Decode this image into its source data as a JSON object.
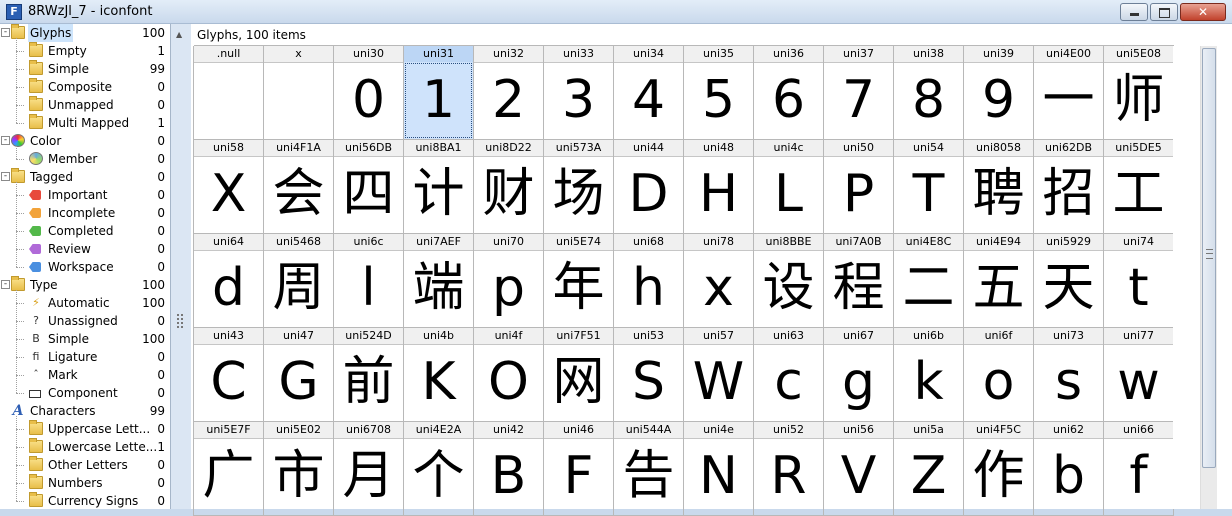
{
  "window": {
    "title": "8RWzJl_7 - iconfont",
    "app_icon_letter": "F",
    "close_glyph": "✕"
  },
  "tree": [
    {
      "label": "Glyphs",
      "count": "100",
      "level": 0,
      "icon": "folder-icon",
      "expander": "-",
      "selected": true
    },
    {
      "label": "Empty",
      "count": "1",
      "level": 1,
      "icon": "folder-icon"
    },
    {
      "label": "Simple",
      "count": "99",
      "level": 1,
      "icon": "folder-icon"
    },
    {
      "label": "Composite",
      "count": "0",
      "level": 1,
      "icon": "folder-icon"
    },
    {
      "label": "Unmapped",
      "count": "0",
      "level": 1,
      "icon": "folder-icon"
    },
    {
      "label": "Multi Mapped",
      "count": "1",
      "level": 1,
      "icon": "folder-icon"
    },
    {
      "label": "Color",
      "count": "0",
      "level": 0,
      "icon": "color-icon",
      "expander": "-"
    },
    {
      "label": "Member",
      "count": "0",
      "level": 1,
      "icon": "member-icon"
    },
    {
      "label": "Tagged",
      "count": "0",
      "level": 0,
      "icon": "folder-icon",
      "expander": "-"
    },
    {
      "label": "Important",
      "count": "0",
      "level": 1,
      "icon": "tag-icon",
      "tag": "t-important"
    },
    {
      "label": "Incomplete",
      "count": "0",
      "level": 1,
      "icon": "tag-icon",
      "tag": "t-incomplete"
    },
    {
      "label": "Completed",
      "count": "0",
      "level": 1,
      "icon": "tag-icon",
      "tag": "t-completed"
    },
    {
      "label": "Review",
      "count": "0",
      "level": 1,
      "icon": "tag-icon",
      "tag": "t-review"
    },
    {
      "label": "Workspace",
      "count": "0",
      "level": 1,
      "icon": "tag-icon",
      "tag": "t-workspace"
    },
    {
      "label": "Type",
      "count": "100",
      "level": 0,
      "icon": "folder-icon",
      "expander": "-"
    },
    {
      "label": "Automatic",
      "count": "100",
      "level": 1,
      "icon": "lightning-icon",
      "glyph": "⚡"
    },
    {
      "label": "Unassigned",
      "count": "0",
      "level": 1,
      "icon": "glyph-icon",
      "glyph": "?"
    },
    {
      "label": "Simple",
      "count": "100",
      "level": 1,
      "icon": "glyph-icon",
      "glyph": "B"
    },
    {
      "label": "Ligature",
      "count": "0",
      "level": 1,
      "icon": "glyph-icon",
      "glyph": "ﬁ"
    },
    {
      "label": "Mark",
      "count": "0",
      "level": 1,
      "icon": "glyph-icon",
      "glyph": "ˆ"
    },
    {
      "label": "Component",
      "count": "0",
      "level": 1,
      "icon": "component-icon"
    },
    {
      "label": "Characters",
      "count": "99",
      "level": 0,
      "icon": "chars-icon",
      "glyph": "A"
    },
    {
      "label": "Uppercase Lett...",
      "count": "0",
      "level": 1,
      "icon": "folder-icon"
    },
    {
      "label": "Lowercase Lette...",
      "count": "1",
      "level": 1,
      "icon": "folder-icon"
    },
    {
      "label": "Other Letters",
      "count": "0",
      "level": 1,
      "icon": "folder-icon"
    },
    {
      "label": "Numbers",
      "count": "0",
      "level": 1,
      "icon": "folder-icon"
    },
    {
      "label": "Currency Signs",
      "count": "0",
      "level": 1,
      "icon": "folder-icon"
    }
  ],
  "glyph_panel": {
    "header": "Glyphs, 100 items",
    "selected_glyph": "uni31",
    "rows": [
      [
        [
          ".null",
          ""
        ],
        [
          "x",
          ""
        ],
        [
          "uni30",
          "0"
        ],
        [
          "uni31",
          "1"
        ],
        [
          "uni32",
          "2"
        ],
        [
          "uni33",
          "3"
        ],
        [
          "uni34",
          "4"
        ],
        [
          "uni35",
          "5"
        ],
        [
          "uni36",
          "6"
        ],
        [
          "uni37",
          "7"
        ],
        [
          "uni38",
          "8"
        ],
        [
          "uni39",
          "9"
        ],
        [
          "uni4E00",
          "一"
        ],
        [
          "uni5E08",
          "师"
        ]
      ],
      [
        [
          "uni58",
          "X"
        ],
        [
          "uni4F1A",
          "会"
        ],
        [
          "uni56DB",
          "四"
        ],
        [
          "uni8BA1",
          "计"
        ],
        [
          "uni8D22",
          "财"
        ],
        [
          "uni573A",
          "场"
        ],
        [
          "uni44",
          "D"
        ],
        [
          "uni48",
          "H"
        ],
        [
          "uni4c",
          "L"
        ],
        [
          "uni50",
          "P"
        ],
        [
          "uni54",
          "T"
        ],
        [
          "uni8058",
          "聘"
        ],
        [
          "uni62DB",
          "招"
        ],
        [
          "uni5DE5",
          "工"
        ]
      ],
      [
        [
          "uni64",
          "d"
        ],
        [
          "uni5468",
          "周"
        ],
        [
          "uni6c",
          "l"
        ],
        [
          "uni7AEF",
          "端"
        ],
        [
          "uni70",
          "p"
        ],
        [
          "uni5E74",
          "年"
        ],
        [
          "uni68",
          "h"
        ],
        [
          "uni78",
          "x"
        ],
        [
          "uni8BBE",
          "设"
        ],
        [
          "uni7A0B",
          "程"
        ],
        [
          "uni4E8C",
          "二"
        ],
        [
          "uni4E94",
          "五"
        ],
        [
          "uni5929",
          "天"
        ],
        [
          "uni74",
          "t"
        ]
      ],
      [
        [
          "uni43",
          "C"
        ],
        [
          "uni47",
          "G"
        ],
        [
          "uni524D",
          "前"
        ],
        [
          "uni4b",
          "K"
        ],
        [
          "uni4f",
          "O"
        ],
        [
          "uni7F51",
          "网"
        ],
        [
          "uni53",
          "S"
        ],
        [
          "uni57",
          "W"
        ],
        [
          "uni63",
          "c"
        ],
        [
          "uni67",
          "g"
        ],
        [
          "uni6b",
          "k"
        ],
        [
          "uni6f",
          "o"
        ],
        [
          "uni73",
          "s"
        ],
        [
          "uni77",
          "w"
        ]
      ],
      [
        [
          "uni5E7F",
          "广"
        ],
        [
          "uni5E02",
          "市"
        ],
        [
          "uni6708",
          "月"
        ],
        [
          "uni4E2A",
          "个"
        ],
        [
          "uni42",
          "B"
        ],
        [
          "uni46",
          "F"
        ],
        [
          "uni544A",
          "告"
        ],
        [
          "uni4e",
          "N"
        ],
        [
          "uni52",
          "R"
        ],
        [
          "uni56",
          "V"
        ],
        [
          "uni5a",
          "Z"
        ],
        [
          "uni4F5C",
          "作"
        ],
        [
          "uni62",
          "b"
        ],
        [
          "uni66",
          "f"
        ]
      ]
    ]
  },
  "splitter_arrow": "▲"
}
